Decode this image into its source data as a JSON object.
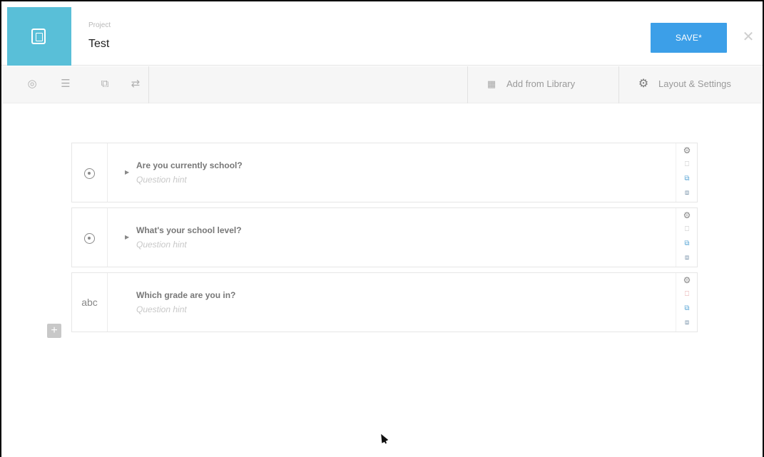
{
  "header": {
    "project_label": "Project",
    "project_name": "Test",
    "save_label": "SAVE*",
    "close_glyph": "✕",
    "brand_color": "#59bfd8",
    "save_color": "#3c9fe8"
  },
  "toolbar": {
    "icons": [
      {
        "name": "preview-icon",
        "glyph": "◎"
      },
      {
        "name": "list-view-icon",
        "glyph": "☰"
      },
      {
        "name": "group-icon",
        "glyph": "⧉"
      },
      {
        "name": "skip-logic-icon",
        "glyph": "⇄"
      }
    ],
    "library_label": "Add from Library",
    "library_glyph": "▦",
    "settings_label": "Layout & Settings",
    "settings_glyph": "⚙"
  },
  "questions": [
    {
      "type": "select_one",
      "type_glyph": "",
      "label": "Are you currently school?",
      "hint": "Question hint"
    },
    {
      "type": "select_one",
      "type_glyph": "",
      "label": "What's your school level?",
      "hint": "Question hint"
    },
    {
      "type": "text",
      "type_glyph": "abc",
      "label": "Which grade are you in?",
      "hint": "Question hint"
    }
  ],
  "row_actions": {
    "settings_glyph": "⚙",
    "delete_glyph": "⎕",
    "duplicate_glyph": "⧉",
    "library_glyph": "⧈"
  },
  "add_question_glyph": "+"
}
